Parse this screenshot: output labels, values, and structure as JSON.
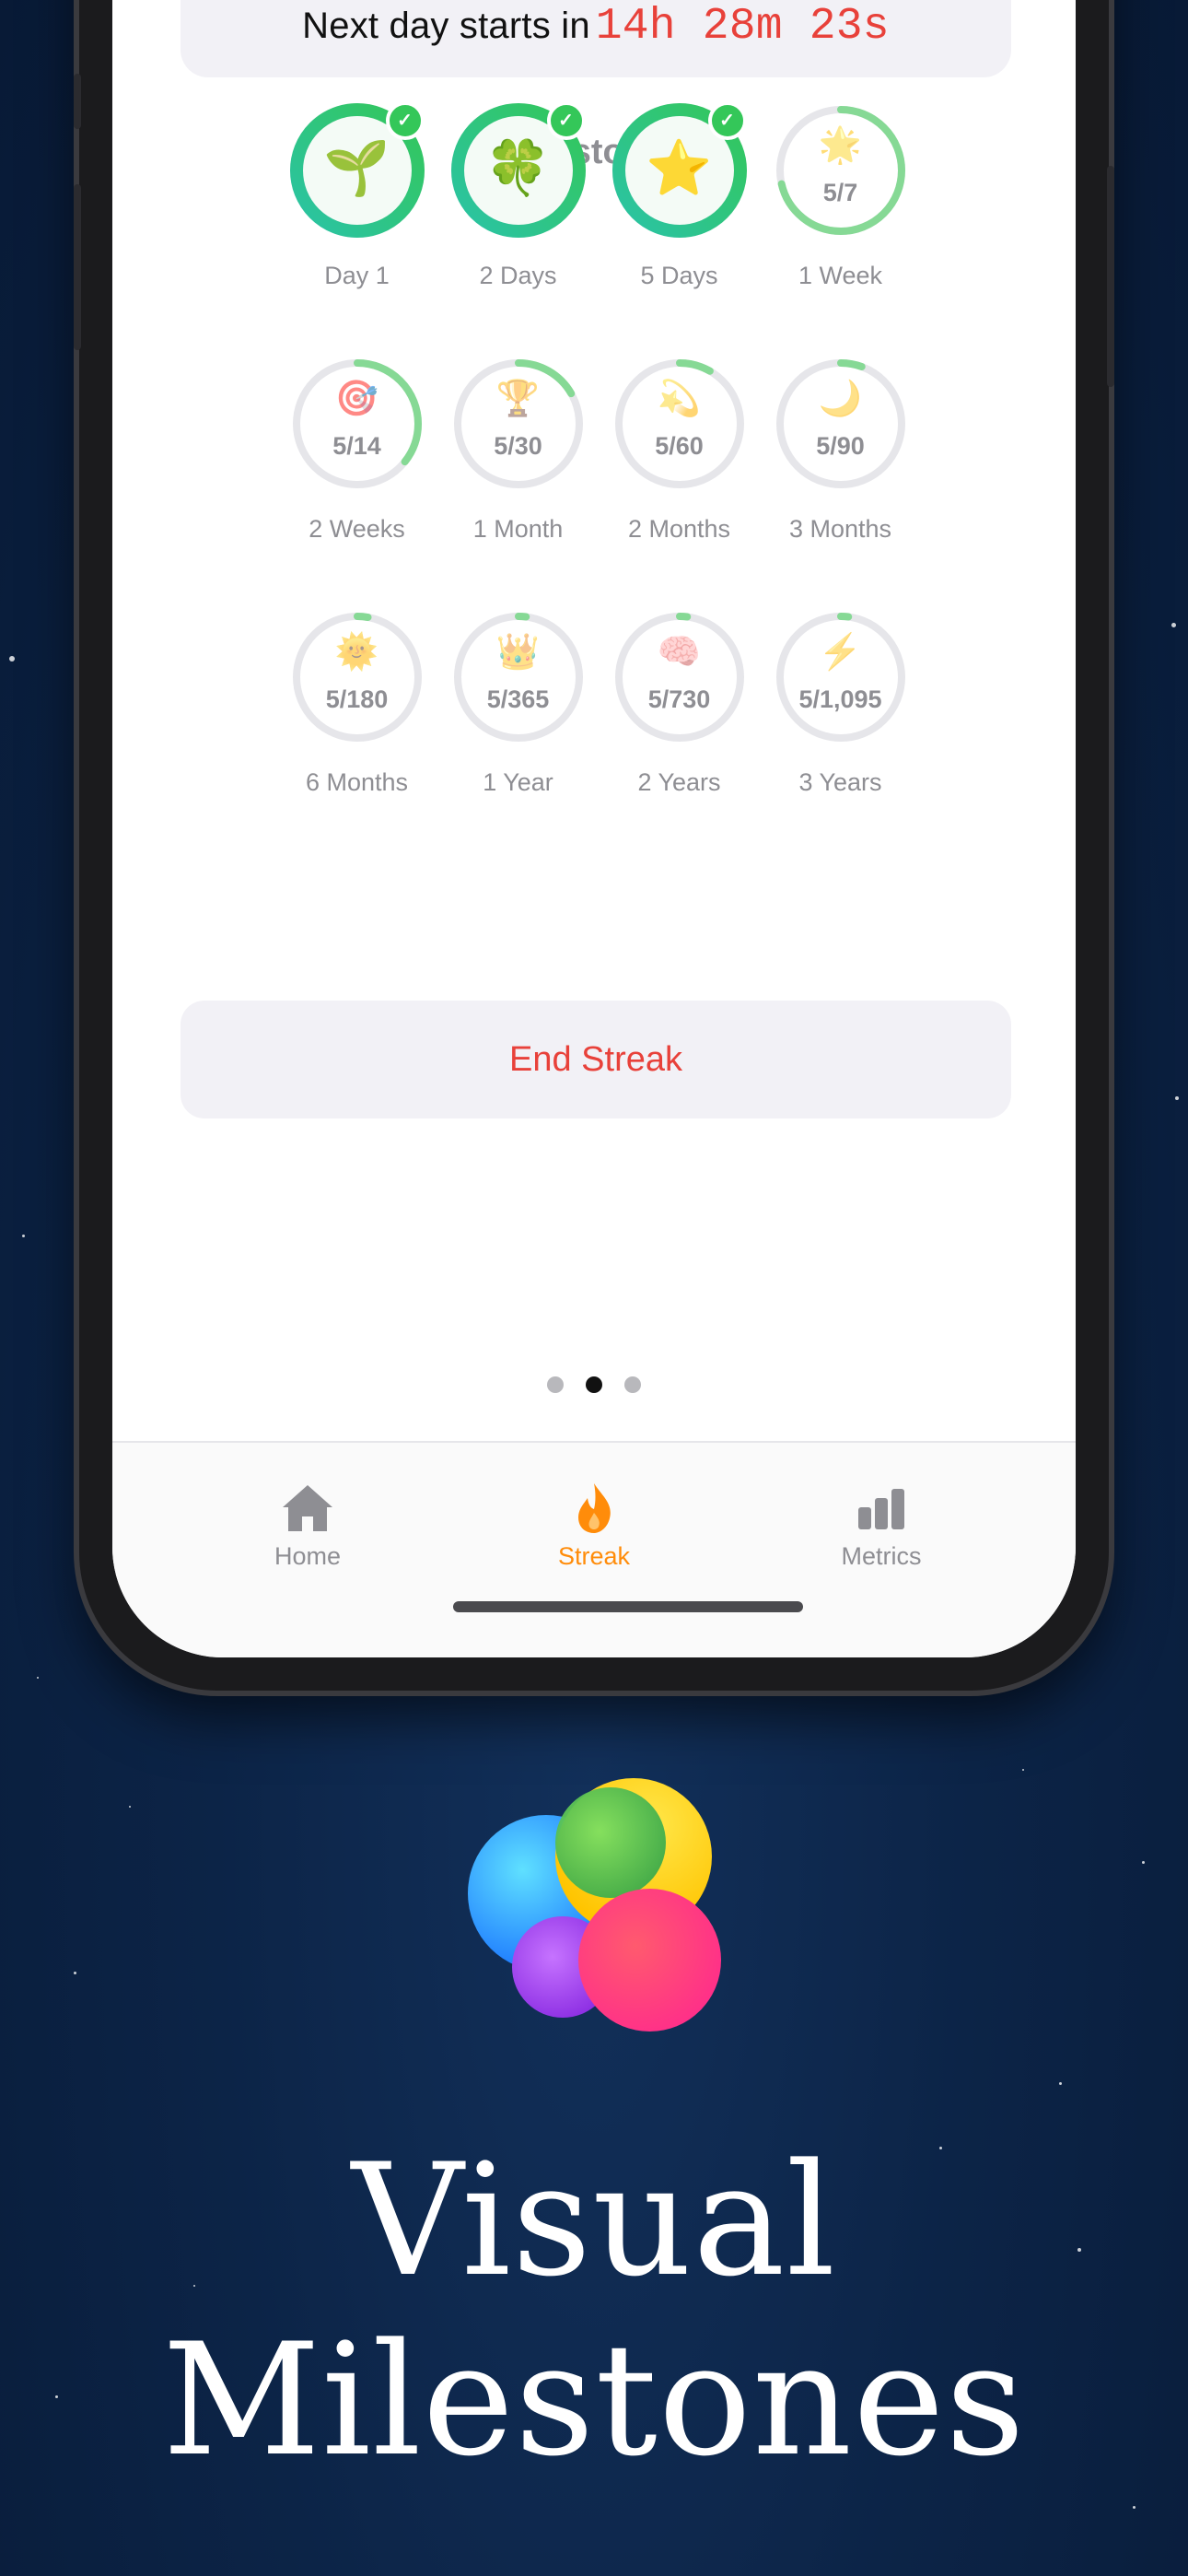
{
  "timer": {
    "prefix": "Next day starts in",
    "value": "14h 28m 23s"
  },
  "milestones": {
    "title": "Milestones",
    "items": [
      {
        "label": "Day 1",
        "icon": "sprout-icon",
        "emoji": "🌱",
        "completed": true,
        "progress_text": "",
        "fraction": 1
      },
      {
        "label": "2 Days",
        "icon": "four-leaf-clover-icon",
        "emoji": "🍀",
        "completed": true,
        "progress_text": "",
        "fraction": 1
      },
      {
        "label": "5 Days",
        "icon": "star-icon",
        "emoji": "⭐",
        "completed": true,
        "progress_text": "",
        "fraction": 1
      },
      {
        "label": "1 Week",
        "icon": "sparkle-star-icon",
        "emoji": "🌟",
        "completed": false,
        "progress_text": "5/7",
        "fraction": 0.714
      },
      {
        "label": "2 Weeks",
        "icon": "target-icon",
        "emoji": "🎯",
        "completed": false,
        "progress_text": "5/14",
        "fraction": 0.357
      },
      {
        "label": "1 Month",
        "icon": "trophy-icon",
        "emoji": "🏆",
        "completed": false,
        "progress_text": "5/30",
        "fraction": 0.167
      },
      {
        "label": "2 Months",
        "icon": "comet-icon",
        "emoji": "💫",
        "completed": false,
        "progress_text": "5/60",
        "fraction": 0.083
      },
      {
        "label": "3 Months",
        "icon": "crescent-moon-icon",
        "emoji": "🌙",
        "completed": false,
        "progress_text": "5/90",
        "fraction": 0.056
      },
      {
        "label": "6 Months",
        "icon": "sun-face-icon",
        "emoji": "🌞",
        "completed": false,
        "progress_text": "5/180",
        "fraction": 0.028
      },
      {
        "label": "1 Year",
        "icon": "crown-icon",
        "emoji": "👑",
        "completed": false,
        "progress_text": "5/365",
        "fraction": 0.014
      },
      {
        "label": "2 Years",
        "icon": "brain-icon",
        "emoji": "🧠",
        "completed": false,
        "progress_text": "5/730",
        "fraction": 0.007
      },
      {
        "label": "3 Years",
        "icon": "lightning-icon",
        "emoji": "⚡",
        "completed": false,
        "progress_text": "5/1,095",
        "fraction": 0.005
      }
    ]
  },
  "end_streak_label": "End Streak",
  "pager": {
    "count": 3,
    "active_index": 1
  },
  "tabs": [
    {
      "label": "Home",
      "icon": "house-icon",
      "active": false
    },
    {
      "label": "Streak",
      "icon": "flame-icon",
      "active": true
    },
    {
      "label": "Metrics",
      "icon": "bar-chart-icon",
      "active": false
    }
  ],
  "headline": {
    "line1": "Visual",
    "line2": "Milestones"
  },
  "colors": {
    "accent_red": "#e8413a",
    "accent_orange": "#ff8c0a",
    "ring_green": "#34c759",
    "ring_teal": "#2ac3a6",
    "background_navy": "#0c2447"
  }
}
